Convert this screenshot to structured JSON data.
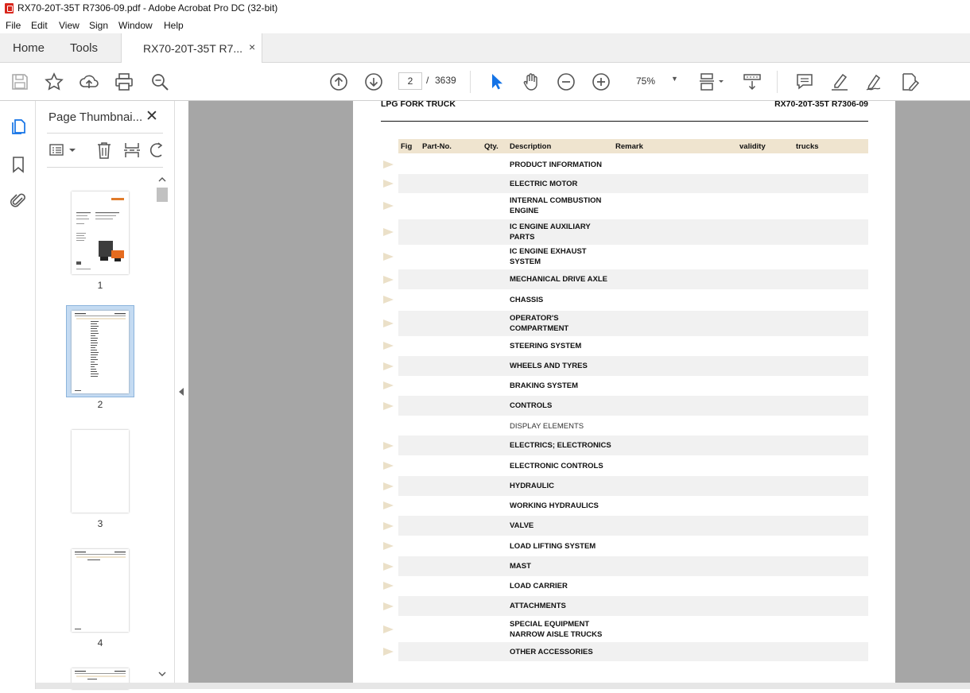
{
  "window": {
    "title": "RX70-20T-35T  R7306-09.pdf - Adobe Acrobat Pro DC (32-bit)"
  },
  "menu": [
    "File",
    "Edit",
    "View",
    "Sign",
    "Window",
    "Help"
  ],
  "tabs": {
    "home": "Home",
    "tools": "Tools",
    "document": "RX70-20T-35T  R7...",
    "close": "×"
  },
  "toolbar": {
    "page_current": "2",
    "page_separator": "/",
    "page_total": "3639",
    "zoom": "75%"
  },
  "thumbnails": {
    "title": "Page Thumbnai...",
    "close": "✕",
    "pages": [
      "1",
      "2",
      "3",
      "4"
    ],
    "selected": "2"
  },
  "document": {
    "header_left": "LPG FORK TRUCK",
    "header_right": "RX70-20T-35T R7306-09",
    "columns": [
      "Fig",
      "Part-No.",
      "Qty.",
      "Description",
      "Remark",
      "validity",
      "trucks"
    ],
    "rows": [
      {
        "lines": [
          "PRODUCT INFORMATION"
        ],
        "arrow": true,
        "shaded": false
      },
      {
        "lines": [
          "ELECTRIC MOTOR"
        ],
        "arrow": true,
        "shaded": true
      },
      {
        "lines": [
          "INTERNAL COMBUSTION",
          "ENGINE"
        ],
        "arrow": true,
        "shaded": false
      },
      {
        "lines": [
          "IC ENGINE AUXILIARY",
          "PARTS"
        ],
        "arrow": true,
        "shaded": true
      },
      {
        "lines": [
          "IC ENGINE EXHAUST",
          "SYSTEM"
        ],
        "arrow": true,
        "shaded": false
      },
      {
        "lines": [
          "MECHANICAL DRIVE AXLE"
        ],
        "arrow": true,
        "shaded": true
      },
      {
        "lines": [
          "CHASSIS"
        ],
        "arrow": true,
        "shaded": false
      },
      {
        "lines": [
          "OPERATOR'S",
          "COMPARTMENT"
        ],
        "arrow": true,
        "shaded": true
      },
      {
        "lines": [
          "STEERING SYSTEM"
        ],
        "arrow": true,
        "shaded": false
      },
      {
        "lines": [
          "WHEELS AND TYRES"
        ],
        "arrow": true,
        "shaded": true
      },
      {
        "lines": [
          "BRAKING SYSTEM"
        ],
        "arrow": true,
        "shaded": false
      },
      {
        "lines": [
          "CONTROLS"
        ],
        "arrow": true,
        "shaded": true
      },
      {
        "lines": [
          "DISPLAY ELEMENTS"
        ],
        "arrow": false,
        "shaded": false,
        "normal": true
      },
      {
        "lines": [
          "ELECTRICS; ELECTRONICS"
        ],
        "arrow": true,
        "shaded": true
      },
      {
        "lines": [
          "ELECTRONIC CONTROLS"
        ],
        "arrow": true,
        "shaded": false
      },
      {
        "lines": [
          "HYDRAULIC"
        ],
        "arrow": true,
        "shaded": true
      },
      {
        "lines": [
          "WORKING HYDRAULICS"
        ],
        "arrow": true,
        "shaded": false
      },
      {
        "lines": [
          "VALVE"
        ],
        "arrow": true,
        "shaded": true
      },
      {
        "lines": [
          "LOAD LIFTING SYSTEM"
        ],
        "arrow": true,
        "shaded": false
      },
      {
        "lines": [
          "MAST"
        ],
        "arrow": true,
        "shaded": true
      },
      {
        "lines": [
          "LOAD CARRIER"
        ],
        "arrow": true,
        "shaded": false
      },
      {
        "lines": [
          "ATTACHMENTS"
        ],
        "arrow": true,
        "shaded": true
      },
      {
        "lines": [
          "SPECIAL EQUIPMENT",
          "NARROW AISLE TRUCKS"
        ],
        "arrow": true,
        "shaded": false
      },
      {
        "lines": [
          "OTHER ACCESSORIES"
        ],
        "arrow": true,
        "shaded": true
      }
    ]
  },
  "colors": {
    "accent_blue": "#1473e6",
    "doc_background": "#a6a6a6",
    "table_header": "#efe4cf",
    "row_shade": "#f1f1f1",
    "arrow": "#ebe0c8",
    "thumb_selected": "#c4dbf2"
  },
  "icons": {
    "rail": [
      "pages-icon",
      "bookmark-icon",
      "attachment-icon"
    ],
    "toolbar": [
      "save-icon",
      "star-icon",
      "upload-icon",
      "print-icon",
      "zoom-search-icon",
      "prev-page-icon",
      "next-page-icon",
      "select-arrow-icon",
      "hand-icon",
      "zoom-out-icon",
      "zoom-in-icon",
      "fit-page-icon",
      "scroll-mode-icon",
      "comment-icon",
      "highlight-icon",
      "sign-icon",
      "edit-pdf-icon"
    ]
  }
}
